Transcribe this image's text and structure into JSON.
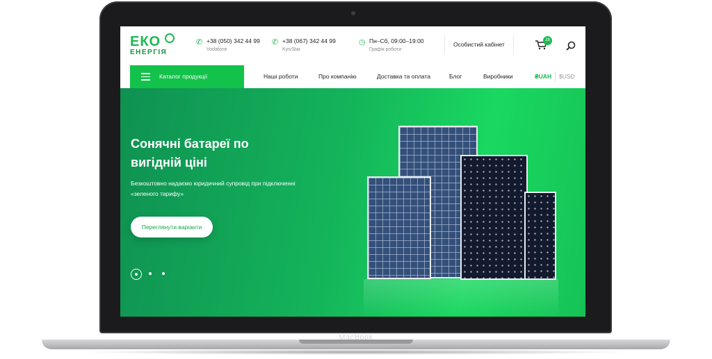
{
  "device": {
    "brand": "MacBook"
  },
  "header": {
    "logo": {
      "line1": "ЕКО",
      "line2": "ЕНЕРГІЯ"
    },
    "contacts": [
      {
        "phone": "+38 (050) 342 44 99",
        "operator": "Vodafone",
        "icon": "phone-icon"
      },
      {
        "phone": "+38 (067) 342 44 99",
        "operator": "KyivStar",
        "icon": "phone-icon"
      },
      {
        "hours": "Пн–Сб, 09:00–19:00",
        "label": "Графік роботи",
        "icon": "clock-icon"
      }
    ],
    "cabinet_label": "Особистий кабінет",
    "cart_count": "28"
  },
  "nav": {
    "catalog_label": "Каталог продукції",
    "items": [
      "Наші роботи",
      "Про компанію",
      "Доставка та оплата",
      "Блог",
      "Виробники"
    ],
    "currency": {
      "active": "₴UAH",
      "inactive": "$USD"
    }
  },
  "hero": {
    "title": "Сонячні батареї по вигідній ціні",
    "subtitle": "Безкоштовно надаємо юридичний супровід при підключенні «зеленого тарифу»",
    "button_label": "Переглянути варіанти",
    "slides_total": 3,
    "slide_active": 1
  },
  "colors": {
    "accent": "#13c24a",
    "hero_start": "#0f9152",
    "hero_end": "#19d860"
  }
}
